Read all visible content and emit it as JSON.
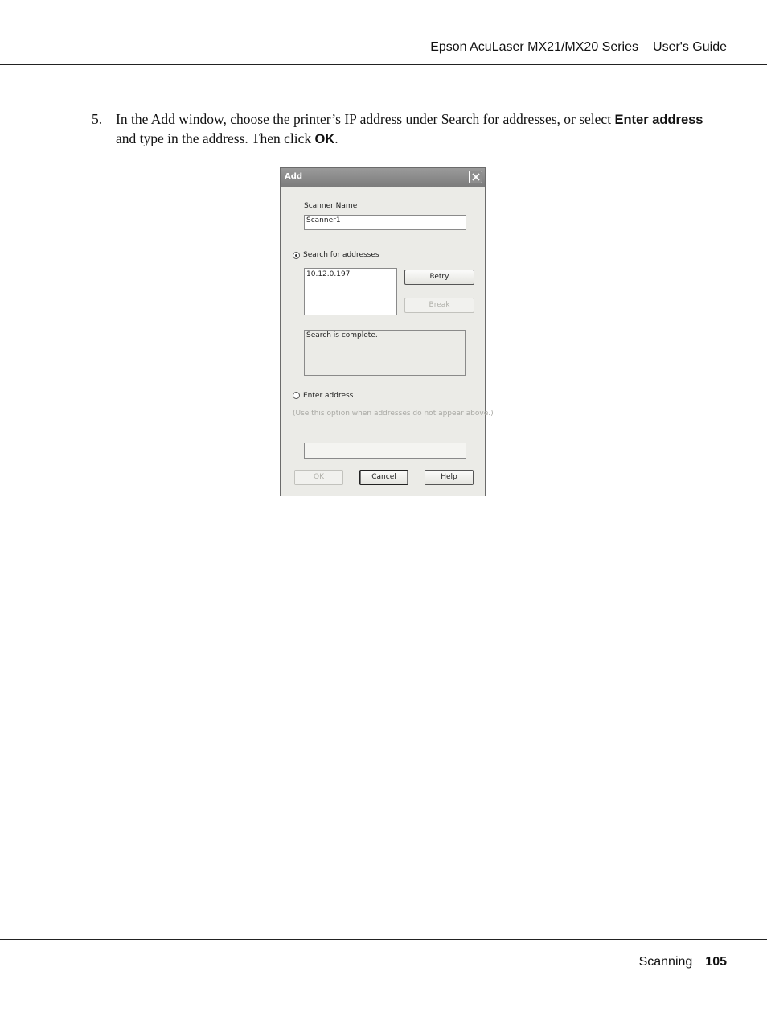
{
  "header": {
    "product": "Epson AcuLaser MX21/MX20 Series",
    "guide": "User's Guide"
  },
  "step": {
    "number": "5.",
    "text_before": "In the Add window, choose the printer’s IP address under Search for addresses, or select ",
    "bold1": "Enter address",
    "text_middle": " and type in the address. Then click ",
    "bold2": "OK",
    "text_after": "."
  },
  "dialog": {
    "title": "Add",
    "scanner_name_label": "Scanner Name",
    "scanner_name_value": "Scanner1",
    "search_radio_label": "Search for addresses",
    "search_selected": true,
    "address_list": [
      "10.12.0.197"
    ],
    "retry_label": "Retry",
    "break_label": "Break",
    "status_text": "Search is complete.",
    "enter_radio_label": "Enter address",
    "enter_hint": "(Use this option when addresses do not appear above.)",
    "enter_address_value": "",
    "ok_label": "OK",
    "cancel_label": "Cancel",
    "help_label": "Help"
  },
  "footer": {
    "section": "Scanning",
    "page": "105"
  }
}
